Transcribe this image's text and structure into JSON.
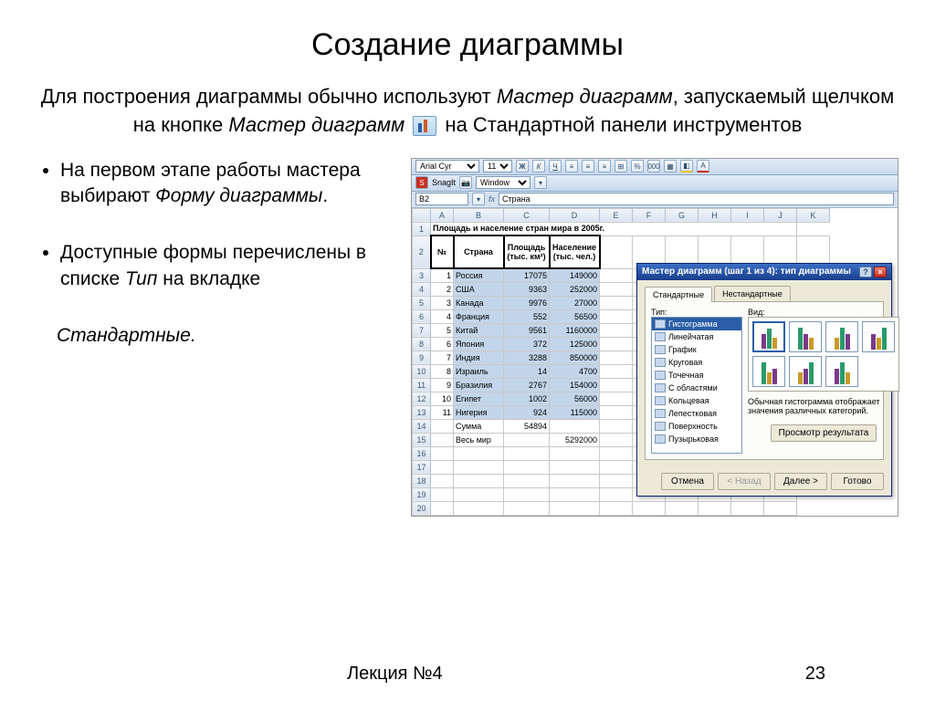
{
  "slide": {
    "title": "Создание диаграммы",
    "intro": "Для построения диаграммы обычно используют <i>Мастер диаграмм</i>, запускаемый щелчком на кнопке <i>Мастер диаграмм</i> <span class=\"wiz-icon\" data-name=\"chart-wizard-icon\" data-interactable=\"false\"></span> на Стандартной панели инструментов",
    "bullets": [
      "На первом этапе работы мастера выбирают <i>Форму диаграммы</i>.",
      "Доступные формы перечислены в списке <i>Тип</i> на вкладке"
    ],
    "subline": "Стандартные",
    "footer_left": "Лекция №4",
    "footer_right": "23"
  },
  "excel": {
    "font_name": "Arial Cyr",
    "font_size": "11",
    "snagit_label": "SnagIt",
    "snagit_target": "Window",
    "name_box": "B2",
    "formula_bar": "Страна",
    "columns": [
      "A",
      "B",
      "C",
      "D",
      "E",
      "F",
      "G",
      "H",
      "I",
      "J",
      "K"
    ],
    "title_row": "Площадь и население стран мира в 2005г.",
    "headers": [
      "№",
      "Страна",
      "Площадь (тыс. км²)",
      "Население (тыс. чел.)"
    ],
    "rows": [
      [
        "1",
        "Россия",
        "17075",
        "149000"
      ],
      [
        "2",
        "США",
        "9363",
        "252000"
      ],
      [
        "3",
        "Канада",
        "9976",
        "27000"
      ],
      [
        "4",
        "Франция",
        "552",
        "56500"
      ],
      [
        "5",
        "Китай",
        "9561",
        "1160000"
      ],
      [
        "6",
        "Япония",
        "372",
        "125000"
      ],
      [
        "7",
        "Индия",
        "3288",
        "850000"
      ],
      [
        "8",
        "Израиль",
        "14",
        "4700"
      ],
      [
        "9",
        "Бразилия",
        "2767",
        "154000"
      ],
      [
        "10",
        "Египет",
        "1002",
        "56000"
      ],
      [
        "11",
        "Нигерия",
        "924",
        "115000"
      ]
    ],
    "sum_label": "Сумма",
    "sum_value": "54894",
    "world_label": "Весь мир",
    "world_value": "5292000"
  },
  "dialog": {
    "title": "Мастер диаграмм (шаг 1 из 4): тип диаграммы",
    "tabs": [
      "Стандартные",
      "Нестандартные"
    ],
    "type_label": "Тип:",
    "view_label": "Вид:",
    "types": [
      "Гистограмма",
      "Линейчатая",
      "График",
      "Круговая",
      "Точечная",
      "С областями",
      "Кольцевая",
      "Лепестковая",
      "Поверхность",
      "Пузырьковая"
    ],
    "description": "Обычная гистограмма отображает значения различных категорий.",
    "preview_btn": "Просмотр результата",
    "buttons": {
      "cancel": "Отмена",
      "back": "< Назад",
      "next": "Далее >",
      "finish": "Готово"
    }
  }
}
